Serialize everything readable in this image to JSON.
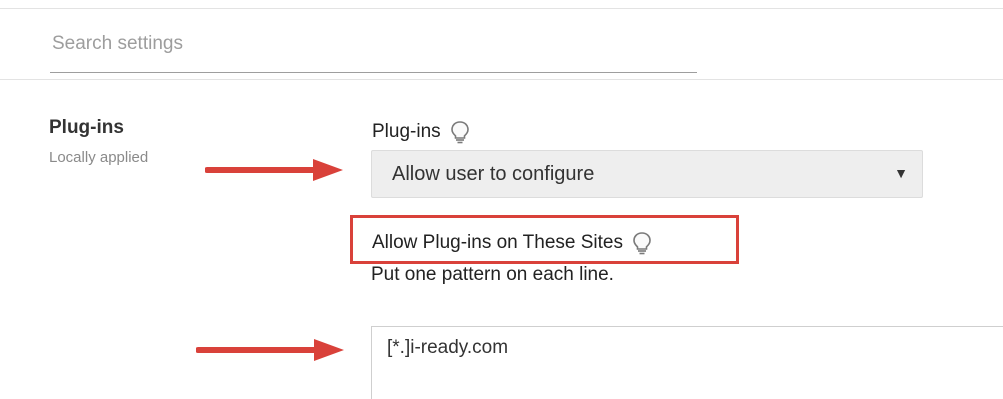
{
  "search": {
    "placeholder": "Search settings"
  },
  "policy": {
    "name": "Plug-ins",
    "scope": "Locally applied",
    "plugins_label": "Plug-ins",
    "plugins_value": "Allow user to configure",
    "allow_sites_label": "Allow Plug-ins on These Sites",
    "allow_sites_help": "Put one pattern on each line.",
    "allow_sites_value": "[*.]i-ready.com"
  },
  "icons": {
    "hint": "lightbulb-icon",
    "dropdown": "caret-down-icon",
    "annotation": "arrow-right-icon"
  },
  "colors": {
    "annotation_red": "#d9413a",
    "select_bg": "#eeeeee"
  },
  "dropdown_caret": "▼"
}
